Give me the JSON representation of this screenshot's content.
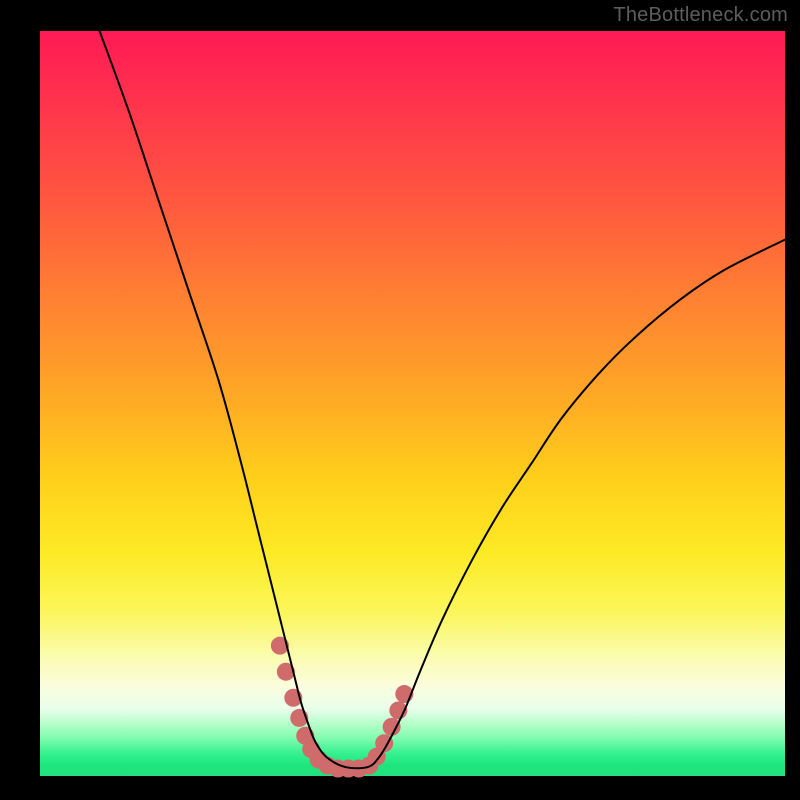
{
  "watermark": "TheBottleneck.com",
  "chart_data": {
    "type": "line",
    "title": "",
    "xlabel": "",
    "ylabel": "",
    "xlim": [
      0,
      100
    ],
    "ylim": [
      0,
      100
    ],
    "series": [
      {
        "name": "curve",
        "x": [
          8,
          12,
          16,
          20,
          24,
          27,
          29,
          31,
          32.5,
          34,
          35,
          36,
          37,
          38.5,
          41,
          44,
          45.5,
          47,
          49,
          51,
          54,
          58,
          62,
          66,
          70,
          75,
          80,
          86,
          92,
          100
        ],
        "y": [
          100,
          89,
          77,
          65,
          53,
          42,
          34,
          26,
          20,
          14,
          10,
          7,
          4.5,
          2.5,
          1.2,
          1.2,
          2.5,
          5,
          9,
          14,
          21,
          29,
          36,
          42,
          48,
          54,
          59,
          64,
          68,
          72
        ],
        "color": "#000000",
        "width": 2
      }
    ],
    "markers": [
      {
        "x": 32.2,
        "y": 17.5
      },
      {
        "x": 33.0,
        "y": 14.0
      },
      {
        "x": 34.0,
        "y": 10.5
      },
      {
        "x": 34.8,
        "y": 7.8
      },
      {
        "x": 35.6,
        "y": 5.4
      },
      {
        "x": 36.4,
        "y": 3.6
      },
      {
        "x": 37.4,
        "y": 2.2
      },
      {
        "x": 38.6,
        "y": 1.4
      },
      {
        "x": 40.0,
        "y": 1.0
      },
      {
        "x": 41.4,
        "y": 1.0
      },
      {
        "x": 42.8,
        "y": 1.0
      },
      {
        "x": 44.2,
        "y": 1.4
      },
      {
        "x": 45.2,
        "y": 2.6
      },
      {
        "x": 46.2,
        "y": 4.4
      },
      {
        "x": 47.2,
        "y": 6.6
      },
      {
        "x": 48.1,
        "y": 8.8
      },
      {
        "x": 48.9,
        "y": 11.0
      }
    ],
    "marker_style": {
      "color": "#cf6b6b",
      "radius": 9
    }
  }
}
